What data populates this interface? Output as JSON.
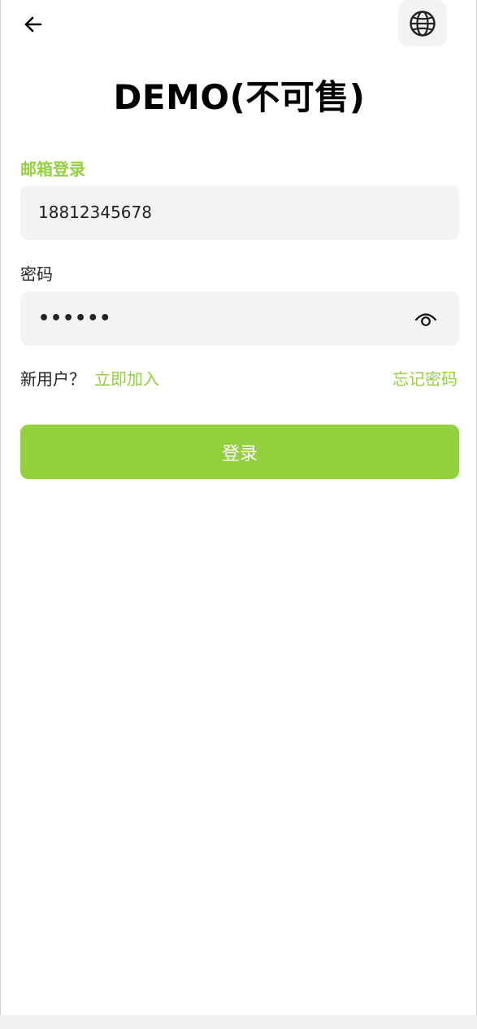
{
  "header": {
    "back_icon": "arrow-left-icon",
    "language_icon": "globe-icon",
    "title": "DEMO(不可售)"
  },
  "form": {
    "login_mode_label": "邮箱登录",
    "account_value": "18812345678",
    "password_label": "密码",
    "password_masked": "••••••",
    "toggle_visibility_icon": "eye-icon"
  },
  "links": {
    "new_user_text": "新用户？",
    "join_label": "立即加入",
    "forgot_label": "忘记密码"
  },
  "actions": {
    "login_label": "登录"
  },
  "colors": {
    "accent": "#93d03d",
    "field_bg": "#f3f3f3",
    "text": "#222222"
  }
}
